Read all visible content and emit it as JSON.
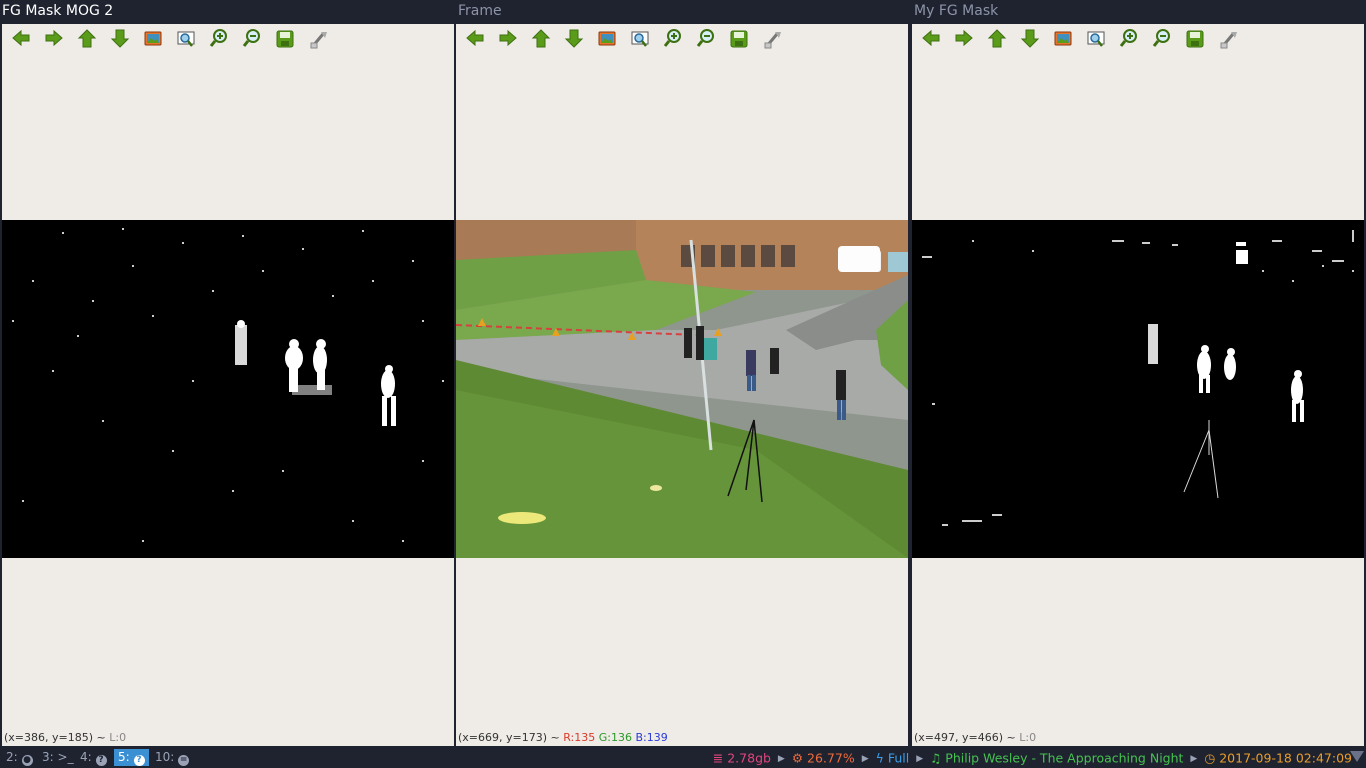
{
  "windows": [
    {
      "title": "FG Mask MOG 2",
      "status": "(x=386, y=185)",
      "sep": "~",
      "level": "L:0"
    },
    {
      "title": "Frame",
      "status": "(x=669, y=173)",
      "sep": "~",
      "r": "R:135",
      "g": "G:136",
      "b": "B:139"
    },
    {
      "title": "My FG Mask",
      "status": "(x=497, y=466)",
      "sep": "~",
      "level": "L:0"
    }
  ],
  "toolbar": [
    {
      "name": "pan-left-icon",
      "tip": "Pan left"
    },
    {
      "name": "pan-right-icon",
      "tip": "Pan right"
    },
    {
      "name": "pan-up-icon",
      "tip": "Pan up"
    },
    {
      "name": "pan-down-icon",
      "tip": "Pan down"
    },
    {
      "name": "zoom-reset-icon",
      "tip": "Zoom reset"
    },
    {
      "name": "zoom-to-window-icon",
      "tip": "Zoom to window"
    },
    {
      "name": "zoom-in-icon",
      "tip": "Zoom in"
    },
    {
      "name": "zoom-out-icon",
      "tip": "Zoom out"
    },
    {
      "name": "save-icon",
      "tip": "Save"
    },
    {
      "name": "properties-icon",
      "tip": "Properties"
    }
  ],
  "taskbar": {
    "workspaces": [
      {
        "label": "2:",
        "icon": "chrome-icon",
        "focused": false
      },
      {
        "label": "3:",
        "icon": ">_",
        "focused": false
      },
      {
        "label": "4:",
        "icon": "?",
        "focused": false
      },
      {
        "label": "5:",
        "icon": "?",
        "focused": true
      },
      {
        "label": "10:",
        "icon": "=",
        "focused": false
      }
    ],
    "memory": "2.78gb",
    "cpu": "26.77%",
    "battery": "Full",
    "music": "Philip Wesley - The Approaching Night",
    "datetime": "2017-09-18 02:47:09"
  },
  "colors": {
    "memory": "#e0457b",
    "cpu": "#f06a3a",
    "battery": "#3b9ee8",
    "music": "#45c24f",
    "datetime": "#e89d2a",
    "workspace_focused": "#3b8fd3"
  }
}
